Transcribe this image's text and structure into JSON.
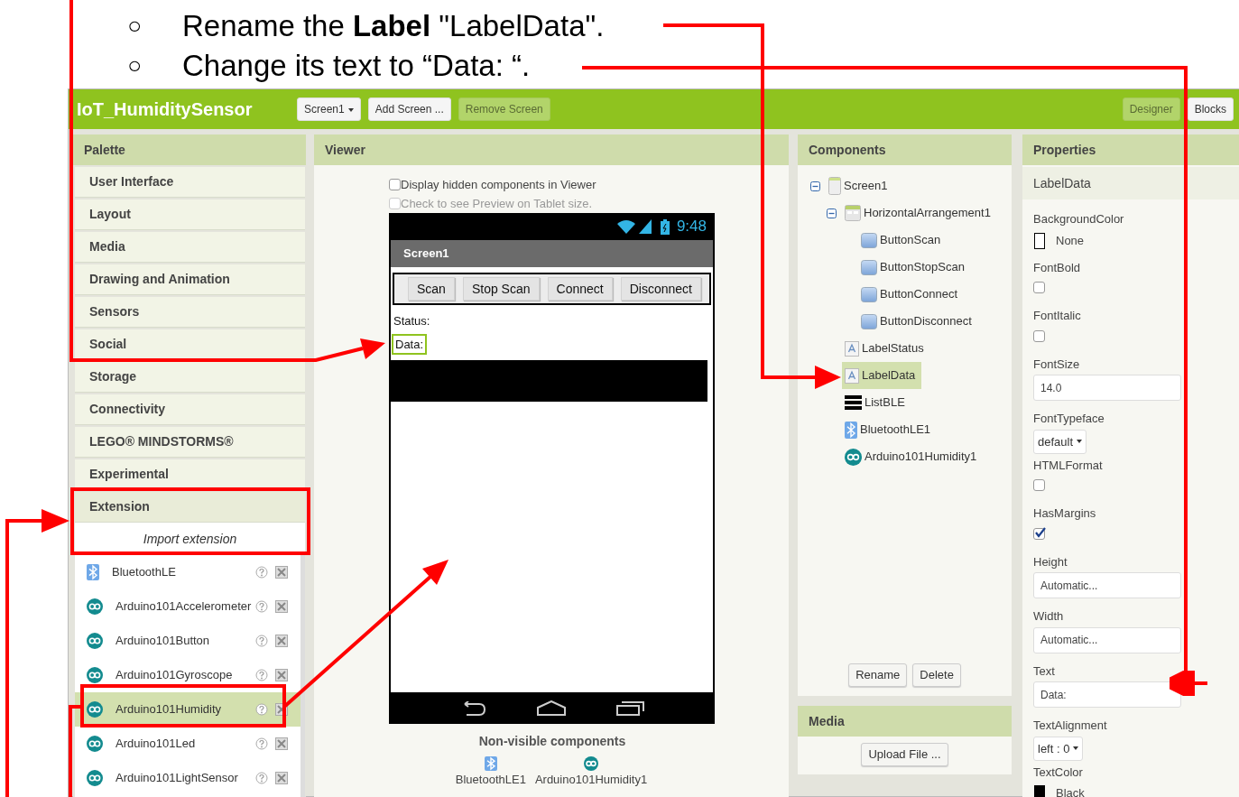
{
  "instructions": [
    {
      "bullet": "○",
      "text": "Rename the **Label** \"LabelData\"."
    },
    {
      "bullet": "○",
      "text": "Change its text to “Data: “."
    }
  ],
  "topbar": {
    "title": "IoT_HumiditySensor",
    "screen_dropdown": "Screen1",
    "buttons": [
      {
        "label": "Add Screen ...",
        "disabled": false
      },
      {
        "label": "Remove Screen",
        "disabled": true
      }
    ],
    "views": [
      {
        "label": "Designer",
        "selected": true
      },
      {
        "label": "Blocks",
        "selected": false
      }
    ]
  },
  "palette": {
    "title": "Palette",
    "categories": [
      {
        "label": "User Interface",
        "expanded": false
      },
      {
        "label": "Layout",
        "expanded": false
      },
      {
        "label": "Media",
        "expanded": false
      },
      {
        "label": "Drawing and Animation",
        "expanded": false
      },
      {
        "label": "Sensors",
        "expanded": false
      },
      {
        "label": "Social",
        "expanded": false
      },
      {
        "label": "Storage",
        "expanded": false
      },
      {
        "label": "Connectivity",
        "expanded": false
      },
      {
        "label": "LEGO® MINDSTORMS®",
        "expanded": false
      },
      {
        "label": "Experimental",
        "expanded": false
      },
      {
        "label": "Extension",
        "expanded": true
      }
    ],
    "import_link": "Import extension",
    "extensions": [
      {
        "name": "BluetoothLE",
        "kind": "bluetooth",
        "selected": false
      },
      {
        "name": "Arduino101Accelerometer",
        "kind": "arduino",
        "selected": false
      },
      {
        "name": "Arduino101Button",
        "kind": "arduino",
        "selected": false
      },
      {
        "name": "Arduino101Gyroscope",
        "kind": "arduino",
        "selected": false
      },
      {
        "name": "Arduino101Humidity",
        "kind": "arduino",
        "selected": true
      },
      {
        "name": "Arduino101Led",
        "kind": "arduino",
        "selected": false
      },
      {
        "name": "Arduino101LightSensor",
        "kind": "arduino",
        "selected": false
      }
    ]
  },
  "viewer": {
    "title": "Viewer",
    "options": [
      {
        "label": "Display hidden components in Viewer",
        "checked": false,
        "disabled": false
      },
      {
        "label": "Check to see Preview on Tablet size.",
        "checked": false,
        "disabled": true
      }
    ],
    "phone": {
      "time": "9:48",
      "screen_title": "Screen1",
      "buttons": [
        "Scan",
        "Stop Scan",
        "Connect",
        "Disconnect"
      ],
      "labels": [
        {
          "text": "Status:",
          "selected": false
        },
        {
          "text": "Data:",
          "selected": true
        }
      ]
    },
    "nonvisible_title": "Non-visible components",
    "nonvisible": [
      {
        "name": "BluetoothLE1",
        "kind": "bluetooth"
      },
      {
        "name": "Arduino101Humidity1",
        "kind": "arduino"
      }
    ]
  },
  "components": {
    "title": "Components",
    "tree": [
      {
        "name": "Screen1",
        "kind": "screen",
        "selected": false,
        "expanded": true,
        "children": [
          {
            "name": "HorizontalArrangement1",
            "kind": "arrangement",
            "selected": false,
            "expanded": true,
            "children": [
              {
                "name": "ButtonScan",
                "kind": "button",
                "selected": false
              },
              {
                "name": "ButtonStopScan",
                "kind": "button",
                "selected": false
              },
              {
                "name": "ButtonConnect",
                "kind": "button",
                "selected": false
              },
              {
                "name": "ButtonDisconnect",
                "kind": "button",
                "selected": false
              }
            ]
          },
          {
            "name": "LabelStatus",
            "kind": "label",
            "selected": false
          },
          {
            "name": "LabelData",
            "kind": "label",
            "selected": true
          },
          {
            "name": "ListBLE",
            "kind": "list",
            "selected": false
          },
          {
            "name": "BluetoothLE1",
            "kind": "bluetooth",
            "selected": false
          },
          {
            "name": "Arduino101Humidity1",
            "kind": "arduino",
            "selected": false
          }
        ]
      }
    ],
    "buttons": [
      "Rename",
      "Delete"
    ]
  },
  "media": {
    "title": "Media",
    "upload": "Upload File ..."
  },
  "properties": {
    "title": "Properties",
    "component": "LabelData",
    "items": [
      {
        "name": "BackgroundColor",
        "kind": "color",
        "value": "None",
        "color": "#ffffff"
      },
      {
        "name": "FontBold",
        "kind": "checkbox",
        "checked": false
      },
      {
        "name": "FontItalic",
        "kind": "checkbox",
        "checked": false
      },
      {
        "name": "FontSize",
        "kind": "text",
        "value": "14.0"
      },
      {
        "name": "FontTypeface",
        "kind": "dropdown",
        "value": "default"
      },
      {
        "name": "HTMLFormat",
        "kind": "checkbox",
        "checked": false
      },
      {
        "name": "HasMargins",
        "kind": "checkbox",
        "checked": true
      },
      {
        "name": "Height",
        "kind": "text",
        "value": "Automatic..."
      },
      {
        "name": "Width",
        "kind": "text",
        "value": "Automatic..."
      },
      {
        "name": "Text",
        "kind": "text",
        "value": "Data:"
      },
      {
        "name": "TextAlignment",
        "kind": "dropdown",
        "value": "left : 0"
      },
      {
        "name": "TextColor",
        "kind": "color",
        "value": "Black",
        "color": "#000000"
      }
    ]
  }
}
